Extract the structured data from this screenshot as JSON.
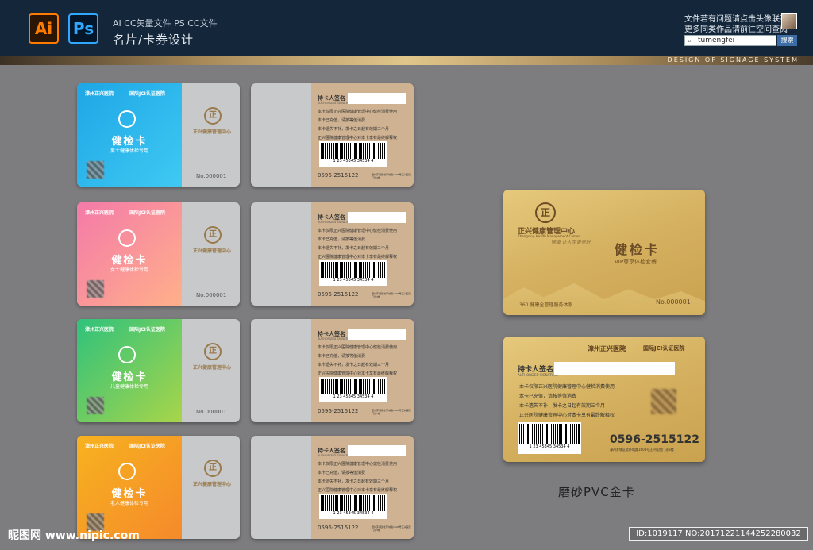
{
  "header": {
    "ai_badge": "Ai",
    "ps_badge": "Ps",
    "formats": "AI CC矢量文件   PS CC文件",
    "title": "名片/卡券设计",
    "contact_line1": "文件若有问题请点击头像联系",
    "contact_line2": "更多同类作品请前往空间查阅",
    "search_value": "tumengfei",
    "search_button": "搜索",
    "banner_text": "DESIGN OF SIGNAGE SYSTEM"
  },
  "cards": [
    {
      "color_from": "#1ea6e6",
      "color_to": "#3fc9f2",
      "hospital": "漳州正兴医院",
      "jci": "国际JCI认证医院",
      "title": "健检卡",
      "subtitle": "男士健康体检专用",
      "number": "No.000001"
    },
    {
      "color_from": "#f47aa9",
      "color_to": "#ffb08a",
      "hospital": "漳州正兴医院",
      "jci": "国际JCI认证医院",
      "title": "健检卡",
      "subtitle": "女士健康体检专用",
      "number": "No.000001"
    },
    {
      "color_from": "#2fc27c",
      "color_to": "#a8d54a",
      "hospital": "漳州正兴医院",
      "jci": "国际JCI认证医院",
      "title": "健检卡",
      "subtitle": "儿童健康体检专用",
      "number": "No.000001"
    },
    {
      "color_from": "#f7b21f",
      "color_to": "#f58a2b",
      "hospital": "漳州正兴医院",
      "jci": "国际JCI认证医院",
      "title": "健检卡",
      "subtitle": "老人健康体检专用",
      "number": ""
    }
  ],
  "card_common": {
    "logo": "正",
    "center_name": "正兴健康管理中心",
    "holder_label": "持卡人签名",
    "auth_label": "AUTHORIZED SIGNATURE",
    "rules": [
      "本卡仅限正兴医院健康管理中心健检消费使用",
      "本卡已充值，请按等值消费",
      "本卡遗失不补，发卡之日起有效期三个月",
      "正兴医院健康管理中心对本卡享有最终解释权"
    ],
    "barcode_number": "1 23 45345 34534 4",
    "tel": "0596-2515122",
    "address": "漳州芗城区北环城路1608号正兴医院门诊3楼"
  },
  "gold_front": {
    "logo": "正",
    "center_name": "正兴健康管理中心",
    "center_en": "Zhengxing Health Management Center",
    "signature": "健康 让人生更美好",
    "title": "健检卡",
    "vip": "VIP尊享体检套餐",
    "system": "360 健康全管理服务体系",
    "number": "No.000001"
  },
  "gold_back": {
    "hospital": "漳州正兴医院",
    "jci": "国际JCI认证医院",
    "holder_label": "持卡人签名",
    "auth_label": "AUTHORIZED SIGNATURE",
    "rules": [
      "本卡仅限正兴医院健康管理中心健检消费使用",
      "本卡已充值，请按等值消费",
      "本卡遗失不补，发卡之日起有效期三个月",
      "正兴医院健康管理中心对本卡享有最终解释权"
    ],
    "barcode_number": "1 23 45345 34534 4",
    "tel": "0596-2515122",
    "address": "漳州芗城区北环城路1608号正兴医院门诊3楼"
  },
  "caption": "磨砂PVC金卡",
  "footer": {
    "watermark": "昵图网 www.nipic.com",
    "id_line": "ID:1019117 NO:20171221144252280032"
  }
}
